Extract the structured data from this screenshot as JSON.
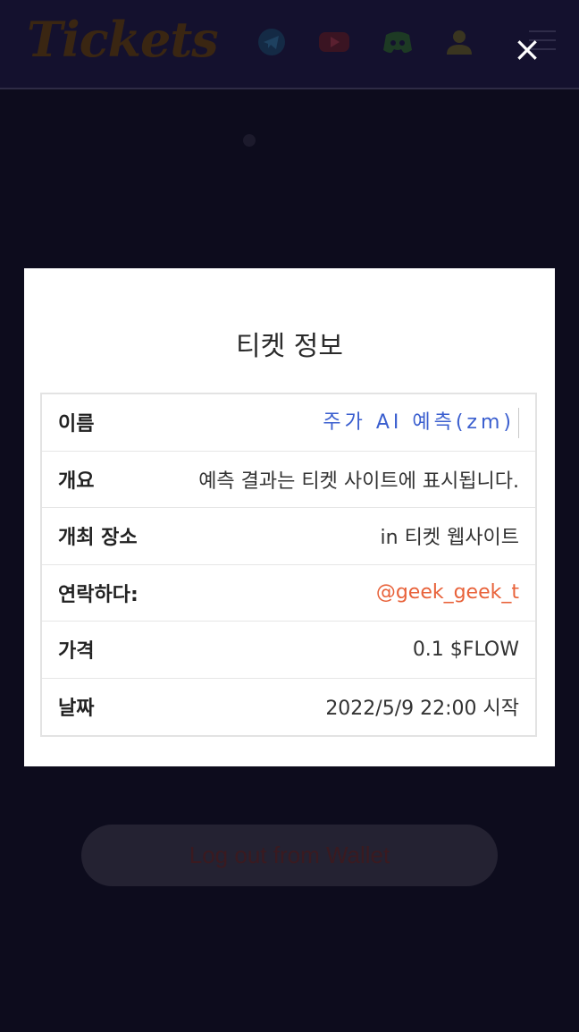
{
  "header": {
    "logo_text": "Tickets",
    "icons": [
      "telegram-icon",
      "youtube-icon",
      "discord-icon",
      "user-icon",
      "menu-icon"
    ]
  },
  "modal": {
    "title": "티켓 정보",
    "close_label": "×",
    "rows": [
      {
        "label": "이름",
        "value": "주가 AI 예측(zm)"
      },
      {
        "label": "개요",
        "value": "예측 결과는 티켓 사이트에 표시됩니다."
      },
      {
        "label": "개최 장소",
        "value": "in 티켓 웹사이트"
      },
      {
        "label": "연락하다:",
        "value": "@geek_geek_t"
      },
      {
        "label": "가격",
        "value": "0.1 $FLOW"
      },
      {
        "label": "날짜",
        "value": "2022/5/9 22:00 시작"
      }
    ]
  },
  "background": {
    "logout_label": "Log out from Wallet"
  },
  "colors": {
    "header_bg": "#14112e",
    "page_bg": "#0d0c1d",
    "name_value": "#3b5fcf",
    "contact_value": "#e8623a"
  }
}
